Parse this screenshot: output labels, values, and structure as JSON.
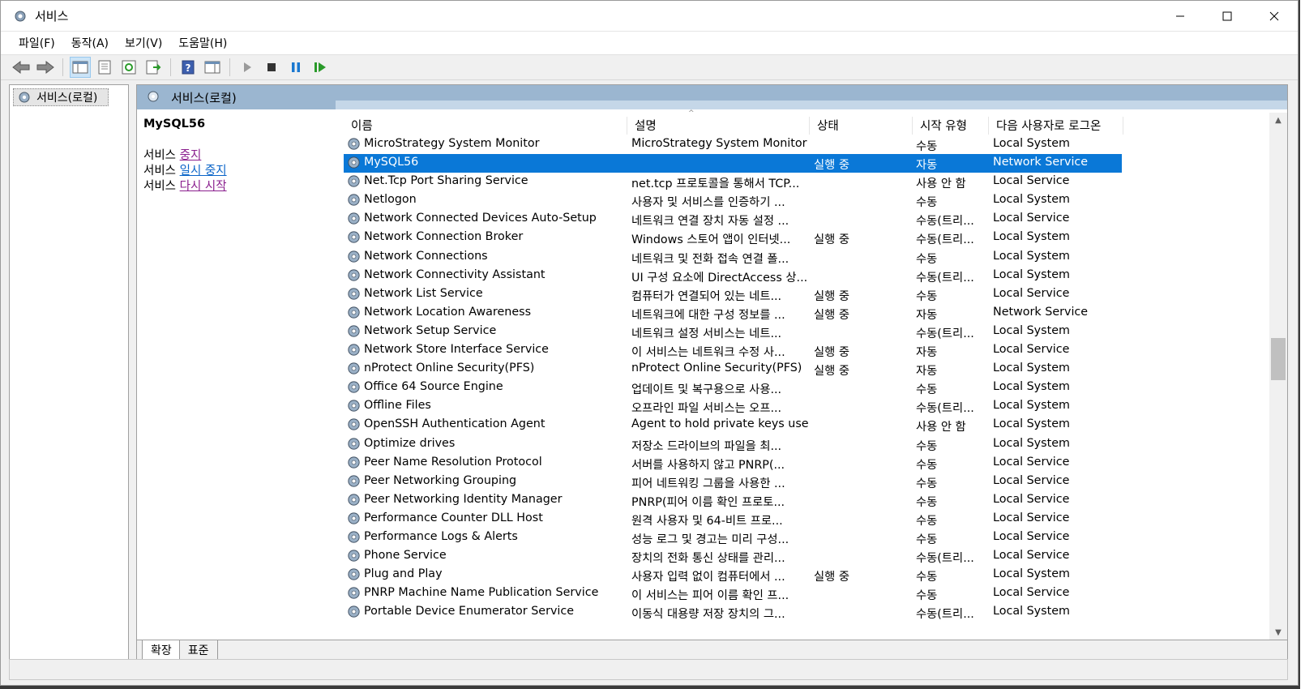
{
  "window": {
    "title": "서비스",
    "menu": [
      "파일(F)",
      "동작(A)",
      "보기(V)",
      "도움말(H)"
    ]
  },
  "tree": {
    "root_label": "서비스(로컬)"
  },
  "panel": {
    "header_title": "서비스(로컬)"
  },
  "detail": {
    "service_name": "MySQL56",
    "action_prefix": "서비스",
    "action_stop": "중지",
    "action_pause": "일시 중지",
    "action_restart": "다시 시작"
  },
  "columns": {
    "name": "이름",
    "description": "설명",
    "status": "상태",
    "startup": "시작 유형",
    "logon": "다음 사용자로 로그온"
  },
  "services": [
    {
      "name": "MicroStrategy System Monitor",
      "desc": "MicroStrategy System Monitor",
      "status": "",
      "startup": "수동",
      "logon": "Local System"
    },
    {
      "name": "MySQL56",
      "desc": "",
      "status": "실행 중",
      "startup": "자동",
      "logon": "Network Service",
      "selected": true
    },
    {
      "name": "Net.Tcp Port Sharing Service",
      "desc": "net.tcp 프로토콜을 통해서 TCP...",
      "status": "",
      "startup": "사용 안 함",
      "logon": "Local Service"
    },
    {
      "name": "Netlogon",
      "desc": "사용자 및 서비스를 인증하기 ...",
      "status": "",
      "startup": "수동",
      "logon": "Local System"
    },
    {
      "name": "Network Connected Devices Auto-Setup",
      "desc": "네트워크 연결 장치 자동 설정 ...",
      "status": "",
      "startup": "수동(트리...",
      "logon": "Local Service"
    },
    {
      "name": "Network Connection Broker",
      "desc": "Windows 스토어 앱이 인터넷...",
      "status": "실행 중",
      "startup": "수동(트리...",
      "logon": "Local System"
    },
    {
      "name": "Network Connections",
      "desc": "네트워크 및 전화 접속 연결 폴...",
      "status": "",
      "startup": "수동",
      "logon": "Local System"
    },
    {
      "name": "Network Connectivity Assistant",
      "desc": "UI 구성 요소에 DirectAccess 상...",
      "status": "",
      "startup": "수동(트리...",
      "logon": "Local System"
    },
    {
      "name": "Network List Service",
      "desc": "컴퓨터가 연결되어 있는 네트...",
      "status": "실행 중",
      "startup": "수동",
      "logon": "Local Service"
    },
    {
      "name": "Network Location Awareness",
      "desc": "네트워크에 대한 구성 정보를 ...",
      "status": "실행 중",
      "startup": "자동",
      "logon": "Network Service"
    },
    {
      "name": "Network Setup Service",
      "desc": "네트워크 설정 서비스는 네트...",
      "status": "",
      "startup": "수동(트리...",
      "logon": "Local System"
    },
    {
      "name": "Network Store Interface Service",
      "desc": "이 서비스는 네트워크 수정 사...",
      "status": "실행 중",
      "startup": "자동",
      "logon": "Local Service"
    },
    {
      "name": "nProtect Online Security(PFS)",
      "desc": "nProtect Online Security(PFS)",
      "status": "실행 중",
      "startup": "자동",
      "logon": "Local System"
    },
    {
      "name": "Office 64 Source Engine",
      "desc": "업데이트 및 복구용으로 사용...",
      "status": "",
      "startup": "수동",
      "logon": "Local System"
    },
    {
      "name": "Offline Files",
      "desc": "오프라인 파일 서비스는 오프...",
      "status": "",
      "startup": "수동(트리...",
      "logon": "Local System"
    },
    {
      "name": "OpenSSH Authentication Agent",
      "desc": "Agent to hold private keys use...",
      "status": "",
      "startup": "사용 안 함",
      "logon": "Local System"
    },
    {
      "name": "Optimize drives",
      "desc": "저장소 드라이브의 파일을 최...",
      "status": "",
      "startup": "수동",
      "logon": "Local System"
    },
    {
      "name": "Peer Name Resolution Protocol",
      "desc": "서버를 사용하지 않고 PNRP(...",
      "status": "",
      "startup": "수동",
      "logon": "Local Service"
    },
    {
      "name": "Peer Networking Grouping",
      "desc": "피어 네트워킹 그룹을 사용한 ...",
      "status": "",
      "startup": "수동",
      "logon": "Local Service"
    },
    {
      "name": "Peer Networking Identity Manager",
      "desc": "PNRP(피어 이름 확인 프로토...",
      "status": "",
      "startup": "수동",
      "logon": "Local Service"
    },
    {
      "name": "Performance Counter DLL Host",
      "desc": "원격 사용자 및 64-비트 프로...",
      "status": "",
      "startup": "수동",
      "logon": "Local Service"
    },
    {
      "name": "Performance Logs & Alerts",
      "desc": "성능 로그 및 경고는 미리 구성...",
      "status": "",
      "startup": "수동",
      "logon": "Local Service"
    },
    {
      "name": "Phone Service",
      "desc": "장치의 전화 통신 상태를 관리...",
      "status": "",
      "startup": "수동(트리...",
      "logon": "Local Service"
    },
    {
      "name": "Plug and Play",
      "desc": "사용자 입력 없이 컴퓨터에서 ...",
      "status": "실행 중",
      "startup": "수동",
      "logon": "Local System"
    },
    {
      "name": "PNRP Machine Name Publication Service",
      "desc": "이 서비스는 피어 이름 확인 프...",
      "status": "",
      "startup": "수동",
      "logon": "Local Service"
    },
    {
      "name": "Portable Device Enumerator Service",
      "desc": "이동식 대용량 저장 장치의 그...",
      "status": "",
      "startup": "수동(트리...",
      "logon": "Local System"
    }
  ],
  "tabs": [
    "확장",
    "표준"
  ],
  "colors": {
    "selection": "#0a78d7",
    "header_band": "#9bb6d0",
    "link_visited": "#8a1f8e",
    "link": "#0a64c8"
  }
}
